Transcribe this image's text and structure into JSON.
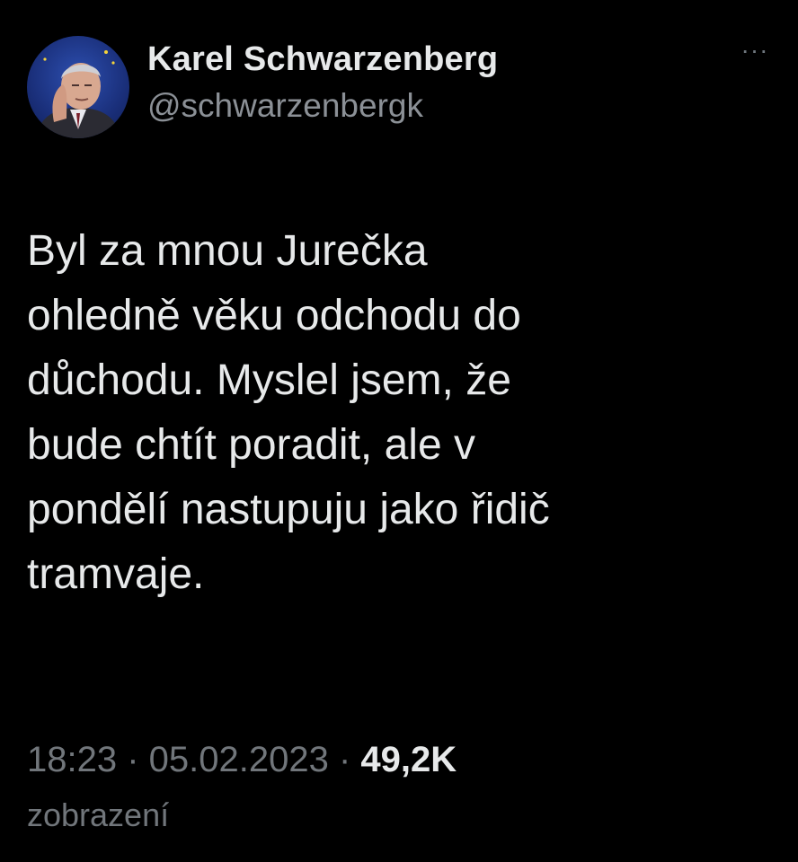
{
  "tweet": {
    "author": {
      "display_name": "Karel Schwarzenberg",
      "handle": "@schwarzenbergk",
      "avatar_icon": "person-avatar"
    },
    "more_icon": "more-options-icon",
    "more_label": "···",
    "text": "Byl za mnou Jurečka\nohledně věku odchodu do\nddůchodu. Myslel jsem, že\nbude chtít poradit, ale v\npondělí nastupuju jako řidič\ntramvaje.",
    "meta": {
      "time": "18:23",
      "separator": " · ",
      "date": "05.02.2023",
      "views_count": "49,2K",
      "views_label": "zobrazení"
    }
  },
  "colors": {
    "background": "#000000",
    "primary_text": "#e7e9ea",
    "secondary_text": "#71767b"
  }
}
